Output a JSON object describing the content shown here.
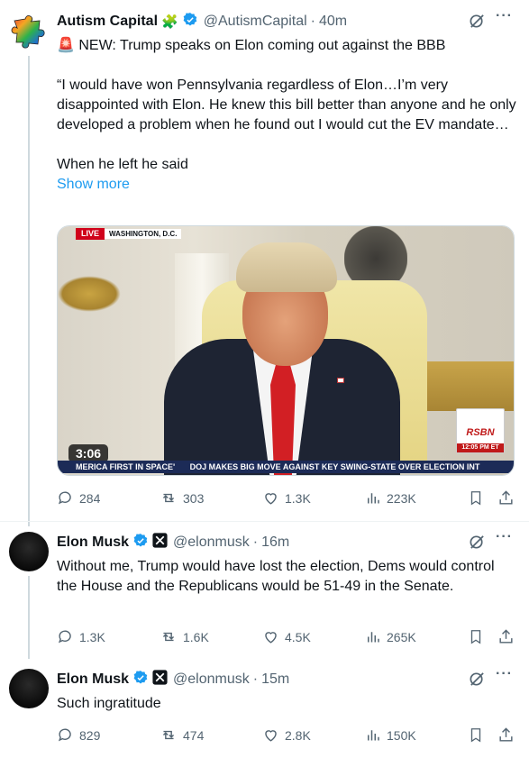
{
  "tweets": [
    {
      "author": "Autism Capital",
      "author_emoji": "🧩",
      "handle": "@AutismCapital",
      "time": "40m",
      "lines": [
        "🚨 NEW: Trump speaks on Elon coming out against the BBB",
        "",
        "“I would have won Pennsylvania regardless of Elon…I’m very disappointed with Elon. He knew this bill better than anyone and he only developed a problem when he found out I would cut the EV mandate…",
        "",
        "When he left he said"
      ],
      "show_more": "Show more",
      "video": {
        "live_label": "LIVE",
        "location": "WASHINGTON, D.C.",
        "duration": "3:06",
        "ticker": [
          "MERICA FIRST IN SPACE'",
          "DOJ MAKES BIG MOVE AGAINST KEY SWING-STATE OVER ELECTION INT"
        ],
        "network": "RSBN",
        "network_time": "12:05 PM ET"
      },
      "replies": "284",
      "reposts": "303",
      "likes": "1.3K",
      "views": "223K"
    },
    {
      "author": "Elon Musk",
      "handle": "@elonmusk",
      "time": "16m",
      "text": "Without me, Trump would have lost the election, Dems would control the House and the Republicans would be 51-49 in the Senate.",
      "replies": "1.3K",
      "reposts": "1.6K",
      "likes": "4.5K",
      "views": "265K"
    },
    {
      "author": "Elon Musk",
      "handle": "@elonmusk",
      "time": "15m",
      "text": "Such ingratitude",
      "replies": "829",
      "reposts": "474",
      "likes": "2.8K",
      "views": "150K"
    }
  ],
  "colors": {
    "verified": "#1d9bf0",
    "link": "#1d9bf0",
    "muted": "#536471",
    "text": "#0f1419"
  }
}
